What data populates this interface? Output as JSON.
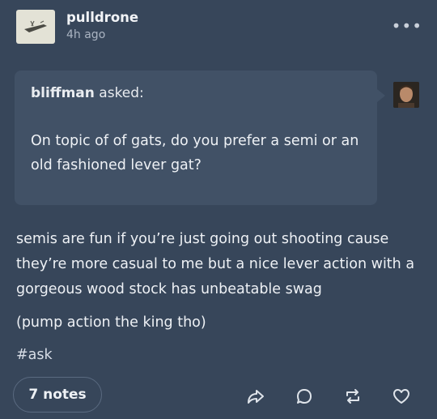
{
  "post": {
    "blog_name": "pulldrone",
    "time": "4h ago",
    "more_icon": "ellipsis-icon"
  },
  "ask": {
    "asker": "bliffman",
    "asked_label": "asked:",
    "question": "On topic of of gats, do you prefer a semi or an old fashioned lever gat?"
  },
  "answer": {
    "paragraph1": "semis are fun if you’re just going out shooting cause they’re more casual to me but a nice lever action with a gorgeous wood stock has unbeatable swag",
    "paragraph2": "(pump action the king tho)",
    "tag": "#ask"
  },
  "footer": {
    "notes_label": "7 notes",
    "icons": [
      "share-icon",
      "reply-icon",
      "reblog-icon",
      "like-icon"
    ]
  },
  "colors": {
    "background": "#37465a",
    "ask_box": "#415166"
  }
}
